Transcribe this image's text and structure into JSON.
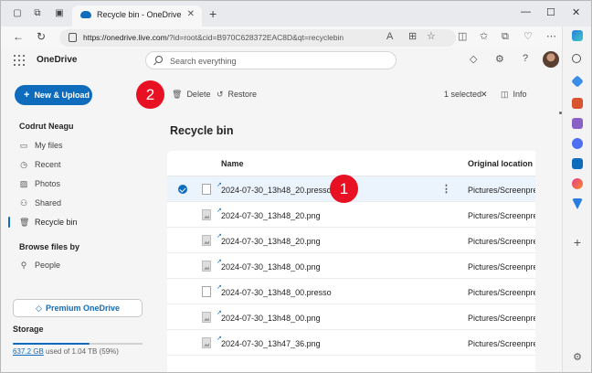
{
  "browser": {
    "tab_title": "Recycle bin - OneDrive",
    "url_host": "https://onedrive.live.com",
    "url_rest": "/?id=root&cid=B970C628372EAC8D&qt=recyclebin"
  },
  "onedrive": {
    "brand": "OneDrive",
    "search_placeholder": "Search everything",
    "new_upload_label": "New & Upload",
    "user_name": "Codrut Neagu",
    "nav": [
      {
        "label": "My files",
        "icon": "folder-icon"
      },
      {
        "label": "Recent",
        "icon": "clock-icon"
      },
      {
        "label": "Photos",
        "icon": "image-icon"
      },
      {
        "label": "Shared",
        "icon": "people-icon"
      },
      {
        "label": "Recycle bin",
        "icon": "trash-icon"
      }
    ],
    "browse_files_by": "Browse files by",
    "people_label": "People",
    "premium_label": "Premium OneDrive",
    "storage_title": "Storage",
    "storage_used": "637.2 GB",
    "storage_rest": " used of 1.04 TB (59%)",
    "storage_fraction": 0.59
  },
  "toolbar": {
    "delete_label": "Delete",
    "restore_label": "Restore",
    "selected_label": "1 selected",
    "info_label": "Info"
  },
  "main": {
    "heading": "Recycle bin",
    "col_name": "Name",
    "col_location": "Original location",
    "files": [
      {
        "name": "2024-07-30_13h48_20.presso",
        "location": "Pictures/Screenpresso",
        "type": "doc",
        "selected": true
      },
      {
        "name": "2024-07-30_13h48_20.png",
        "location": "Pictures/Screenpresso",
        "type": "img",
        "selected": false
      },
      {
        "name": "2024-07-30_13h48_20.png",
        "location": "Pictures/Screenpresso",
        "type": "img",
        "selected": false
      },
      {
        "name": "2024-07-30_13h48_00.png",
        "location": "Pictures/Screenpresso",
        "type": "img",
        "selected": false
      },
      {
        "name": "2024-07-30_13h48_00.presso",
        "location": "Pictures/Screenpresso",
        "type": "doc",
        "selected": false
      },
      {
        "name": "2024-07-30_13h48_00.png",
        "location": "Pictures/Screenpresso",
        "type": "img",
        "selected": false
      },
      {
        "name": "2024-07-30_13h47_36.png",
        "location": "Pictures/Screenpresso",
        "type": "img",
        "selected": false
      }
    ]
  },
  "badges": {
    "one": "1",
    "two": "2"
  },
  "colors": {
    "accent": "#0f6cbd",
    "badge": "#e81123"
  }
}
